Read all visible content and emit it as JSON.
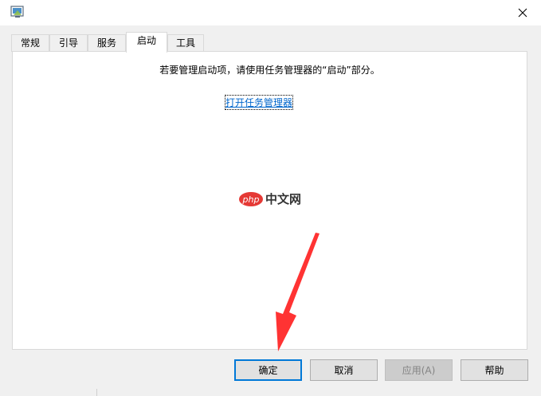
{
  "tabs": [
    {
      "label": "常规"
    },
    {
      "label": "引导"
    },
    {
      "label": "服务"
    },
    {
      "label": "启动"
    },
    {
      "label": "工具"
    }
  ],
  "active_tab": "启动",
  "panel": {
    "message": "若要管理启动项，请使用任务管理器的“启动”部分。",
    "link_text": "打开任务管理器"
  },
  "watermark": {
    "logo_text": "php",
    "text": "中文网"
  },
  "buttons": {
    "ok": "确定",
    "cancel": "取消",
    "apply": "应用(A)",
    "help": "帮助"
  },
  "colors": {
    "accent": "#0078d7",
    "link": "#0066cc",
    "arrow": "#ff3333",
    "watermark_logo": "#e53935"
  },
  "icons": {
    "app": "msconfig-icon",
    "close": "close-icon"
  }
}
